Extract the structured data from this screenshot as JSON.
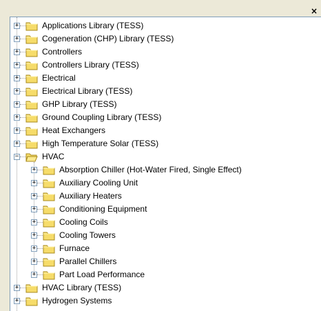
{
  "panel": {
    "close_glyph": "×"
  },
  "tree": {
    "root_items": [
      {
        "label": "Applications Library (TESS)",
        "expander": "+",
        "icon": "folder-icon"
      },
      {
        "label": "Cogeneration (CHP) Library (TESS)",
        "expander": "+",
        "icon": "folder-icon"
      },
      {
        "label": "Controllers",
        "expander": "+",
        "icon": "folder-icon"
      },
      {
        "label": "Controllers Library (TESS)",
        "expander": "+",
        "icon": "folder-icon"
      },
      {
        "label": "Electrical",
        "expander": "+",
        "icon": "folder-icon"
      },
      {
        "label": "Electrical Library (TESS)",
        "expander": "+",
        "icon": "folder-icon"
      },
      {
        "label": "GHP Library (TESS)",
        "expander": "+",
        "icon": "folder-icon"
      },
      {
        "label": "Ground Coupling Library (TESS)",
        "expander": "+",
        "icon": "folder-icon"
      },
      {
        "label": "Heat Exchangers",
        "expander": "+",
        "icon": "folder-icon"
      },
      {
        "label": "High Temperature Solar (TESS)",
        "expander": "+",
        "icon": "folder-icon"
      },
      {
        "label": "HVAC",
        "expander": "−",
        "icon": "open-folder-icon"
      }
    ],
    "hvac_children": [
      {
        "label": "Absorption Chiller (Hot-Water Fired, Single Effect)",
        "expander": "+"
      },
      {
        "label": "Auxiliary Cooling Unit",
        "expander": "+"
      },
      {
        "label": "Auxiliary Heaters",
        "expander": "+"
      },
      {
        "label": "Conditioning Equipment",
        "expander": "+"
      },
      {
        "label": "Cooling Coils",
        "expander": "+"
      },
      {
        "label": "Cooling Towers",
        "expander": "+"
      },
      {
        "label": "Furnace",
        "expander": "+"
      },
      {
        "label": "Parallel Chillers",
        "expander": "+"
      },
      {
        "label": "Part Load Performance",
        "expander": "+"
      }
    ],
    "trailing_items": [
      {
        "label": "HVAC Library (TESS)",
        "expander": "+"
      },
      {
        "label": "Hydrogen Systems",
        "expander": "+"
      }
    ]
  },
  "colors": {
    "folder_fill": "#f6dc6a",
    "folder_stroke": "#a88a1c",
    "pane_border": "#7f9db9"
  }
}
